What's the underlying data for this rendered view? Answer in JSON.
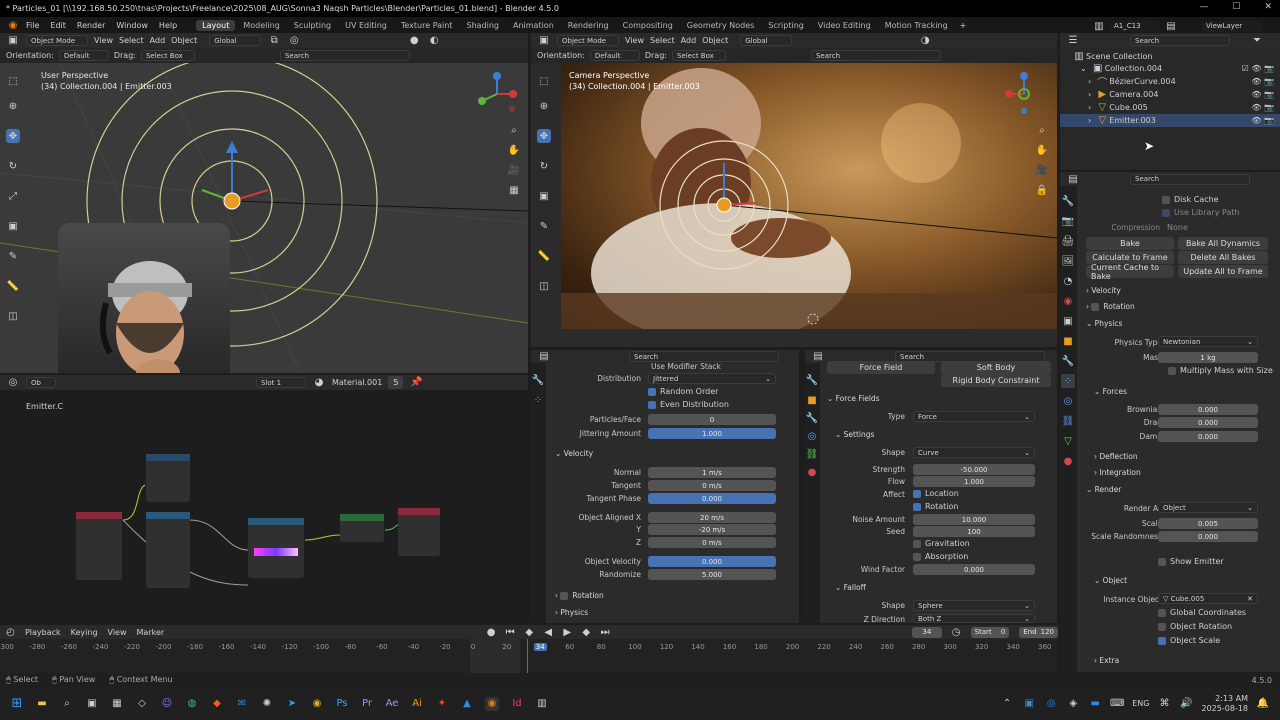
{
  "window": {
    "title": "* Particles_01 [\\\\192.168.50.250\\tnas\\Projects\\Freelance\\2025\\08_AUG\\Sonna3 Naqsh Particles\\Blender\\Particles_01.blend] - Blender 4.5.0"
  },
  "menu": [
    "File",
    "Edit",
    "Render",
    "Window",
    "Help"
  ],
  "workspaces": [
    "Layout",
    "Modeling",
    "Sculpting",
    "UV Editing",
    "Texture Paint",
    "Shading",
    "Animation",
    "Rendering",
    "Compositing",
    "Geometry Nodes",
    "Scripting",
    "Video Editing",
    "Motion Tracking"
  ],
  "scene_name": "A1_C13",
  "view_layer": "ViewLayer",
  "header": {
    "object_mode": "Object Mode",
    "view": "View",
    "select": "Select",
    "add": "Add",
    "object": "Object",
    "global": "Global",
    "orientation": "Orientation:",
    "orientation_val": "Default",
    "drag": "Drag:",
    "select_box": "Select Box",
    "search": "Search"
  },
  "viewport_left": {
    "persp": "User Perspective",
    "collection": "(34) Collection.004 | Emitter.003"
  },
  "viewport_right": {
    "persp": "Camera Perspective",
    "collection": "(34) Collection.004 | Emitter.003"
  },
  "node_editor": {
    "object": "Ob",
    "slot": "Slot 1",
    "material": "Material.001",
    "users": "5",
    "emitter": "Emitter.C"
  },
  "outliner": {
    "scene_collection": "Scene Collection",
    "collection": "Collection.004",
    "items": [
      "BézierCurve.004",
      "Camera.004",
      "Cube.005",
      "Emitter.003"
    ]
  },
  "particles_panel": {
    "stack_label": "Use Modifier Stack",
    "distribution_label": "Distribution",
    "distribution": "Jittered",
    "random_order": "Random Order",
    "even_distribution": "Even Distribution",
    "particles_face_label": "Particles/Face",
    "particles_face": "0",
    "jitter_label": "Jittering Amount",
    "jitter": "1.000",
    "velocity": "Velocity",
    "normal_label": "Normal",
    "normal": "1 m/s",
    "tangent_label": "Tangent",
    "tangent": "0 m/s",
    "tangent_phase_label": "Tangent Phase",
    "tangent_phase": "0.000",
    "obj_aligned_x_label": "Object Aligned X",
    "obj_aligned_x": "20 m/s",
    "y_label": "Y",
    "y": "-20 m/s",
    "z_label": "Z",
    "z": "0 m/s",
    "obj_vel_label": "Object Velocity",
    "obj_vel": "0.000",
    "randomize_label": "Randomize",
    "randomize": "5.000",
    "rotation": "Rotation",
    "physics": "Physics"
  },
  "force_panel": {
    "force_field_tab": "Force Field",
    "soft_body": "Soft Body",
    "rigid_body": "Rigid Body Constraint",
    "force_fields": "Force Fields",
    "type_label": "Type",
    "type": "Force",
    "settings": "Settings",
    "shape_label": "Shape",
    "shape": "Curve",
    "strength_label": "Strength",
    "strength": "-50.000",
    "flow_label": "Flow",
    "flow": "1.000",
    "affect_label": "Affect",
    "location": "Location",
    "rotation": "Rotation",
    "noise_label": "Noise Amount",
    "noise": "10.000",
    "seed_label": "Seed",
    "seed": "100",
    "gravitation": "Gravitation",
    "absorption": "Absorption",
    "wind_label": "Wind Factor",
    "wind": "0.000",
    "falloff": "Falloff",
    "falloff_shape_label": "Shape",
    "falloff_shape": "Sphere",
    "zdir_label": "Z Direction",
    "zdir": "Both Z"
  },
  "properties": {
    "search": "Search",
    "disk_cache": "Disk Cache",
    "use_library_path": "Use Library Path",
    "compression_label": "Compression",
    "compression": "None",
    "bake": "Bake",
    "bake_all": "Bake All Dynamics",
    "calc_frame": "Calculate to Frame",
    "delete_bakes": "Delete All Bakes",
    "current_cache": "Current Cache to Bake",
    "update_all": "Update All to Frame",
    "velocity": "Velocity",
    "rotation": "Rotation",
    "physics": "Physics",
    "physics_type_label": "Physics Type",
    "physics_type": "Newtonian",
    "mass_label": "Mass",
    "mass": "1 kg",
    "multiply_mass": "Multiply Mass with Size",
    "forces": "Forces",
    "brownian_label": "Brownian",
    "brownian": "0.000",
    "drag_label": "Drag",
    "drag": "0.000",
    "damp_label": "Damp",
    "damp": "0.000",
    "deflection": "Deflection",
    "integration": "Integration",
    "render": "Render",
    "render_as_label": "Render As",
    "render_as": "Object",
    "scale_label": "Scale",
    "scale": "0.005",
    "scale_rand_label": "Scale Randomness",
    "scale_rand": "0.000",
    "show_emitter": "Show Emitter",
    "object": "Object",
    "instance_label": "Instance Object",
    "instance": "Cube.005",
    "global_coords": "Global Coordinates",
    "object_rotation": "Object Rotation",
    "object_scale": "Object Scale",
    "extra": "Extra"
  },
  "timeline": {
    "playback": "Playback",
    "keying": "Keying",
    "view": "View",
    "marker": "Marker",
    "frame": "34",
    "start_label": "Start",
    "start": "0",
    "end_label": "End",
    "end": "120",
    "ticks": [
      "-300",
      "-280",
      "-260",
      "-240",
      "-220",
      "-200",
      "-180",
      "-160",
      "-140",
      "-120",
      "-100",
      "-80",
      "-60",
      "-40",
      "-20",
      "0",
      "20",
      "34",
      "60",
      "80",
      "100",
      "120",
      "140",
      "160",
      "180",
      "200",
      "220",
      "240",
      "260",
      "280",
      "300",
      "320",
      "340",
      "360"
    ]
  },
  "status": {
    "select": "Select",
    "pan": "Pan View",
    "context": "Context Menu",
    "version": "4.5.0"
  },
  "taskbar": {
    "lang": "ENG",
    "time": "2:13 AM",
    "date": "2025-08-18"
  }
}
